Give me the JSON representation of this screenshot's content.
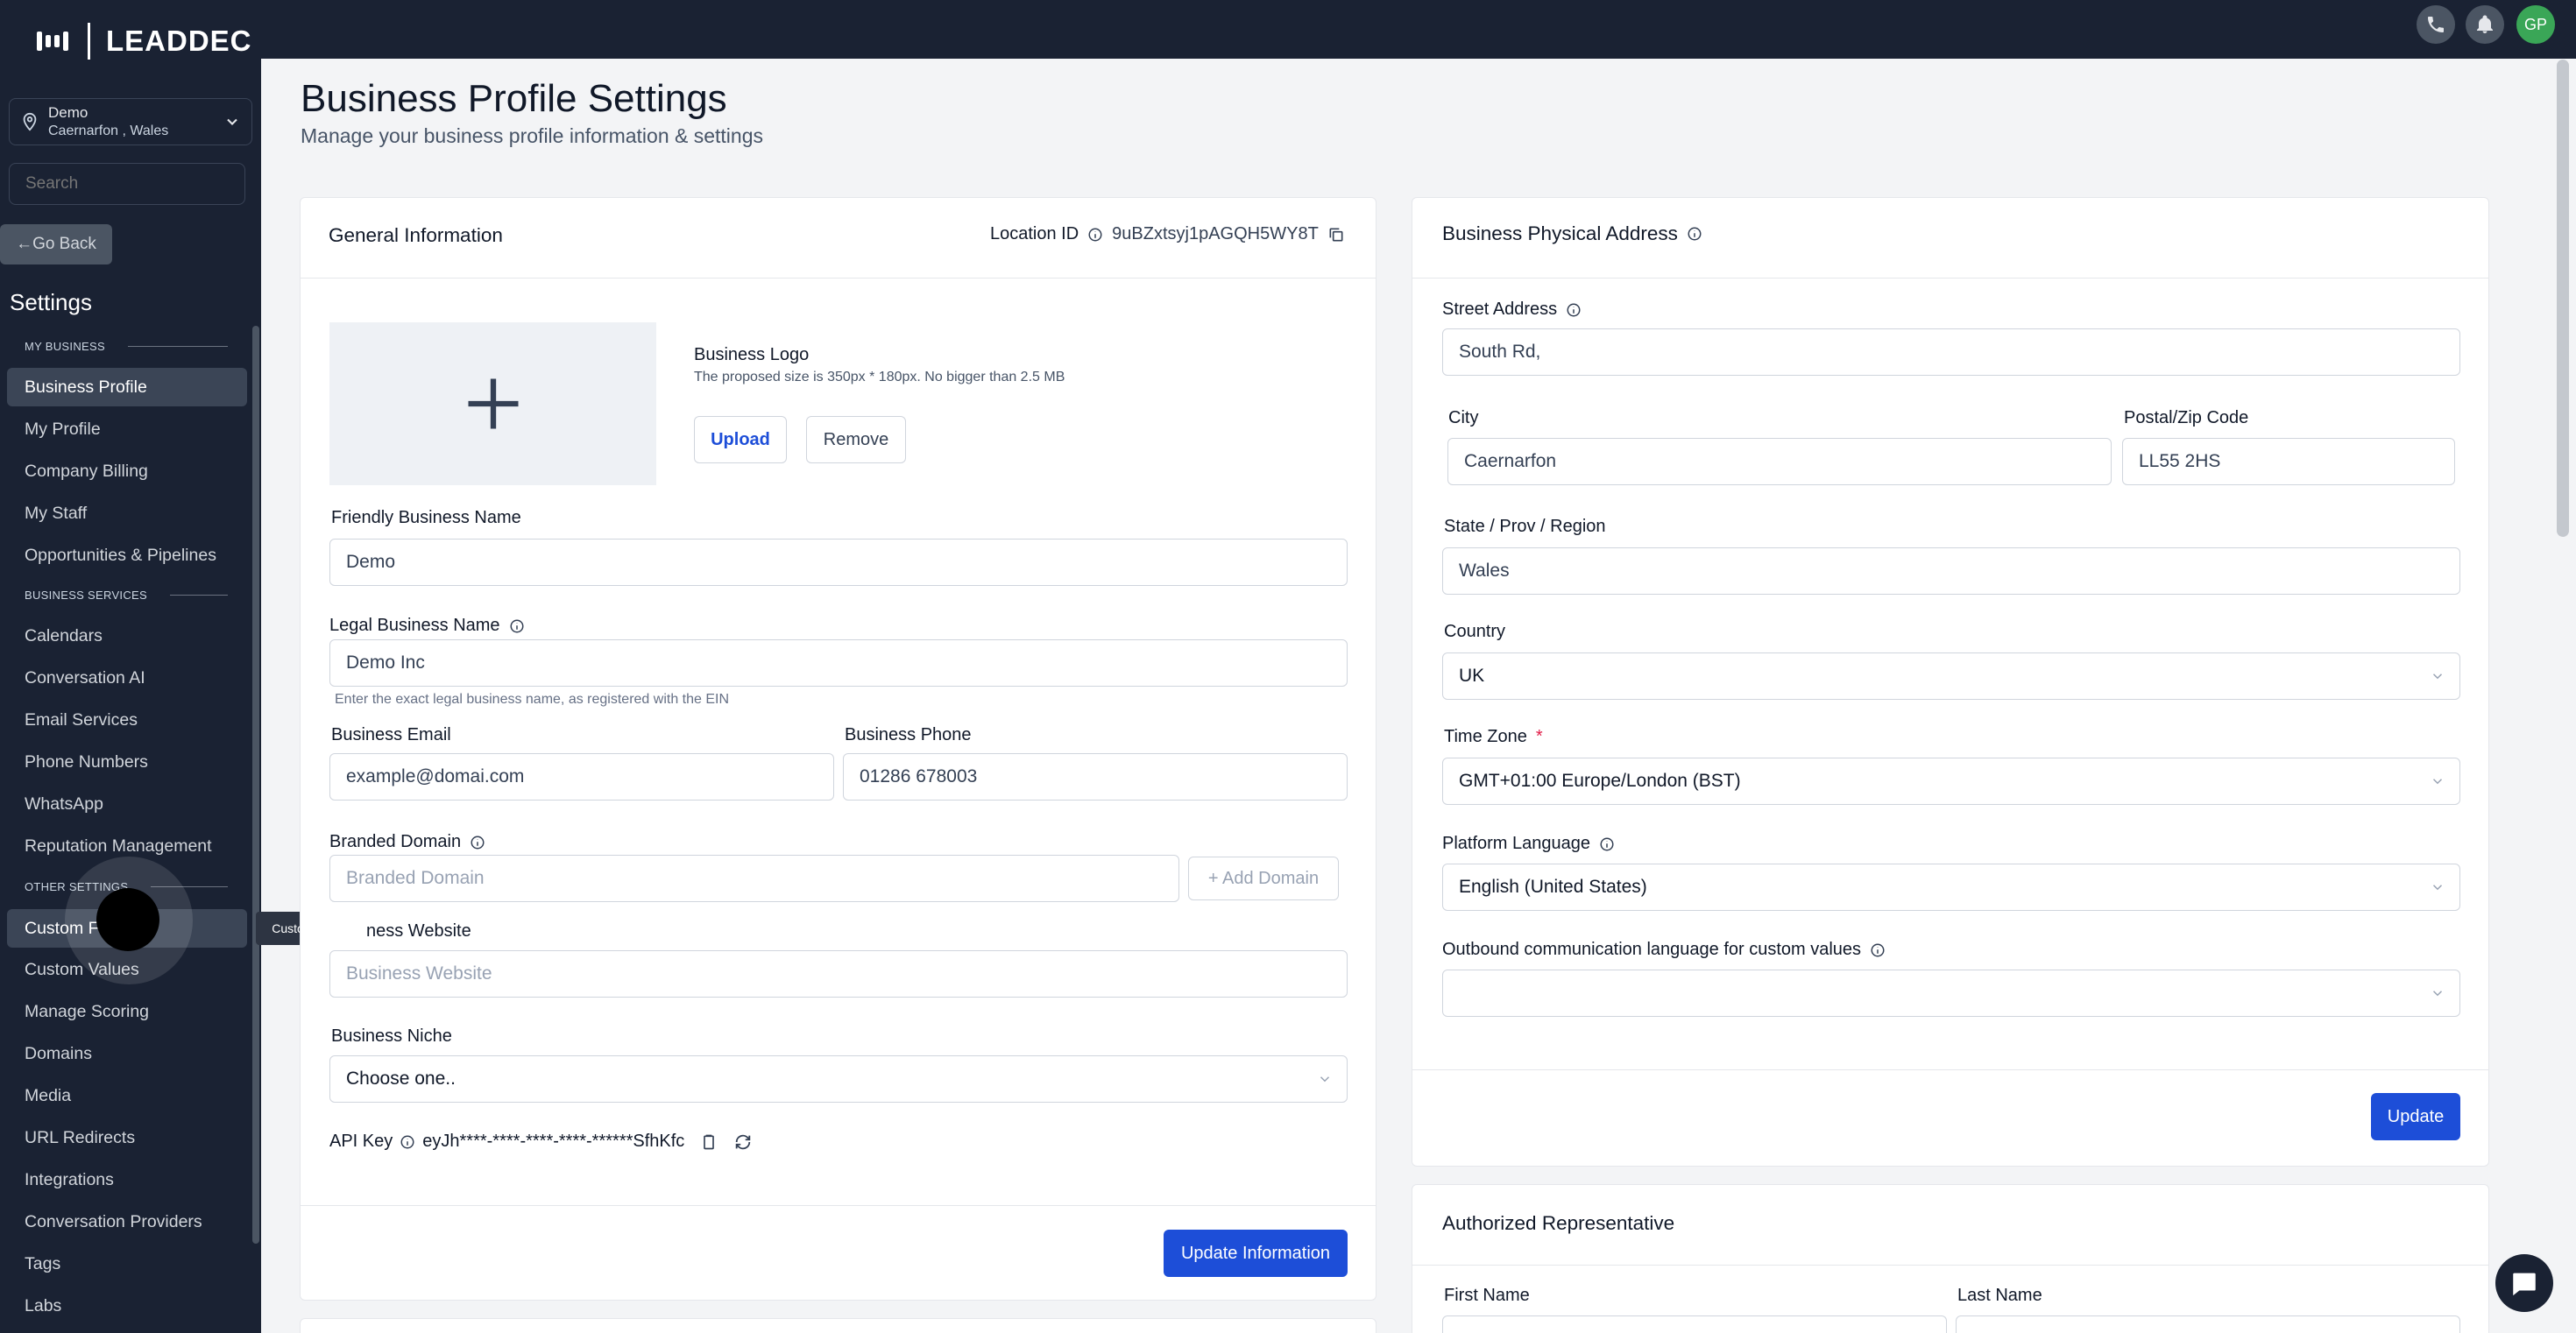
{
  "brand": {
    "name": "LEADDEC"
  },
  "location_switcher": {
    "name": "Demo",
    "address": "Caernarfon , Wales"
  },
  "search": {
    "placeholder": "Search"
  },
  "go_back": {
    "label": "Go Back",
    "arrow": "←"
  },
  "settings_title": "Settings",
  "sidebar": {
    "sections": [
      {
        "label": "MY BUSINESS",
        "items": [
          "Business Profile",
          "My Profile",
          "Company Billing",
          "My Staff",
          "Opportunities & Pipelines"
        ]
      },
      {
        "label": "BUSINESS SERVICES",
        "items": [
          "Calendars",
          "Conversation AI",
          "Email Services",
          "Phone Numbers",
          "WhatsApp",
          "Reputation Management"
        ]
      },
      {
        "label": "OTHER SETTINGS",
        "items": [
          "Custom F",
          "Custom Values",
          "Manage Scoring",
          "Domains",
          "Media",
          "URL Redirects",
          "Integrations",
          "Conversation Providers",
          "Tags",
          "Labs"
        ]
      }
    ],
    "active_item": "Business Profile",
    "tooltip": "Custom Fields"
  },
  "topbar": {
    "avatar_initials": "GP",
    "icons": [
      "phone-icon",
      "bell-icon"
    ]
  },
  "page": {
    "title": "Business Profile Settings",
    "subtitle": "Manage your business profile information & settings"
  },
  "general": {
    "title": "General Information",
    "location_id_label": "Location ID",
    "location_id": "9uBZxtsyj1pAGQH5WY8T",
    "logo": {
      "title": "Business Logo",
      "hint": "The proposed size is 350px * 180px. No bigger than 2.5 MB",
      "upload": "Upload",
      "remove": "Remove"
    },
    "friendly_name": {
      "label": "Friendly Business Name",
      "value": "Demo"
    },
    "legal_name": {
      "label": "Legal Business Name",
      "value": "Demo Inc",
      "helper": "Enter the exact legal business name, as registered with the EIN"
    },
    "email": {
      "label": "Business Email",
      "value": "example@domai.com"
    },
    "phone": {
      "label": "Business Phone",
      "value": "01286 678003"
    },
    "branded_domain": {
      "label": "Branded Domain",
      "placeholder": "Branded Domain",
      "add_button": "+ Add Domain"
    },
    "website": {
      "label": "ness Website",
      "placeholder": "Business Website"
    },
    "niche": {
      "label": "Business Niche",
      "value": "Choose one.."
    },
    "api_key": {
      "label": "API Key",
      "value": "eyJh****-****-****-****-******SfhKfc"
    },
    "update_button": "Update Information"
  },
  "address": {
    "title": "Business Physical Address",
    "street": {
      "label": "Street Address",
      "value": "South Rd,"
    },
    "city": {
      "label": "City",
      "value": "Caernarfon"
    },
    "postal": {
      "label": "Postal/Zip Code",
      "value": "LL55 2HS"
    },
    "state": {
      "label": "State / Prov / Region",
      "value": "Wales"
    },
    "country": {
      "label": "Country",
      "value": "UK"
    },
    "timezone": {
      "label": "Time Zone",
      "required_mark": "*",
      "value": "GMT+01:00 Europe/London (BST)"
    },
    "language": {
      "label": "Platform Language",
      "value": "English (United States)"
    },
    "outbound_language": {
      "label": "Outbound communication language for custom values",
      "value": ""
    },
    "update_button": "Update"
  },
  "representative": {
    "title": "Authorized Representative",
    "first_name": {
      "label": "First Name"
    },
    "last_name": {
      "label": "Last Name"
    }
  },
  "colors": {
    "sidebar": "#1a2233",
    "primary": "#1d4ed8",
    "avatar": "#3aa657"
  }
}
